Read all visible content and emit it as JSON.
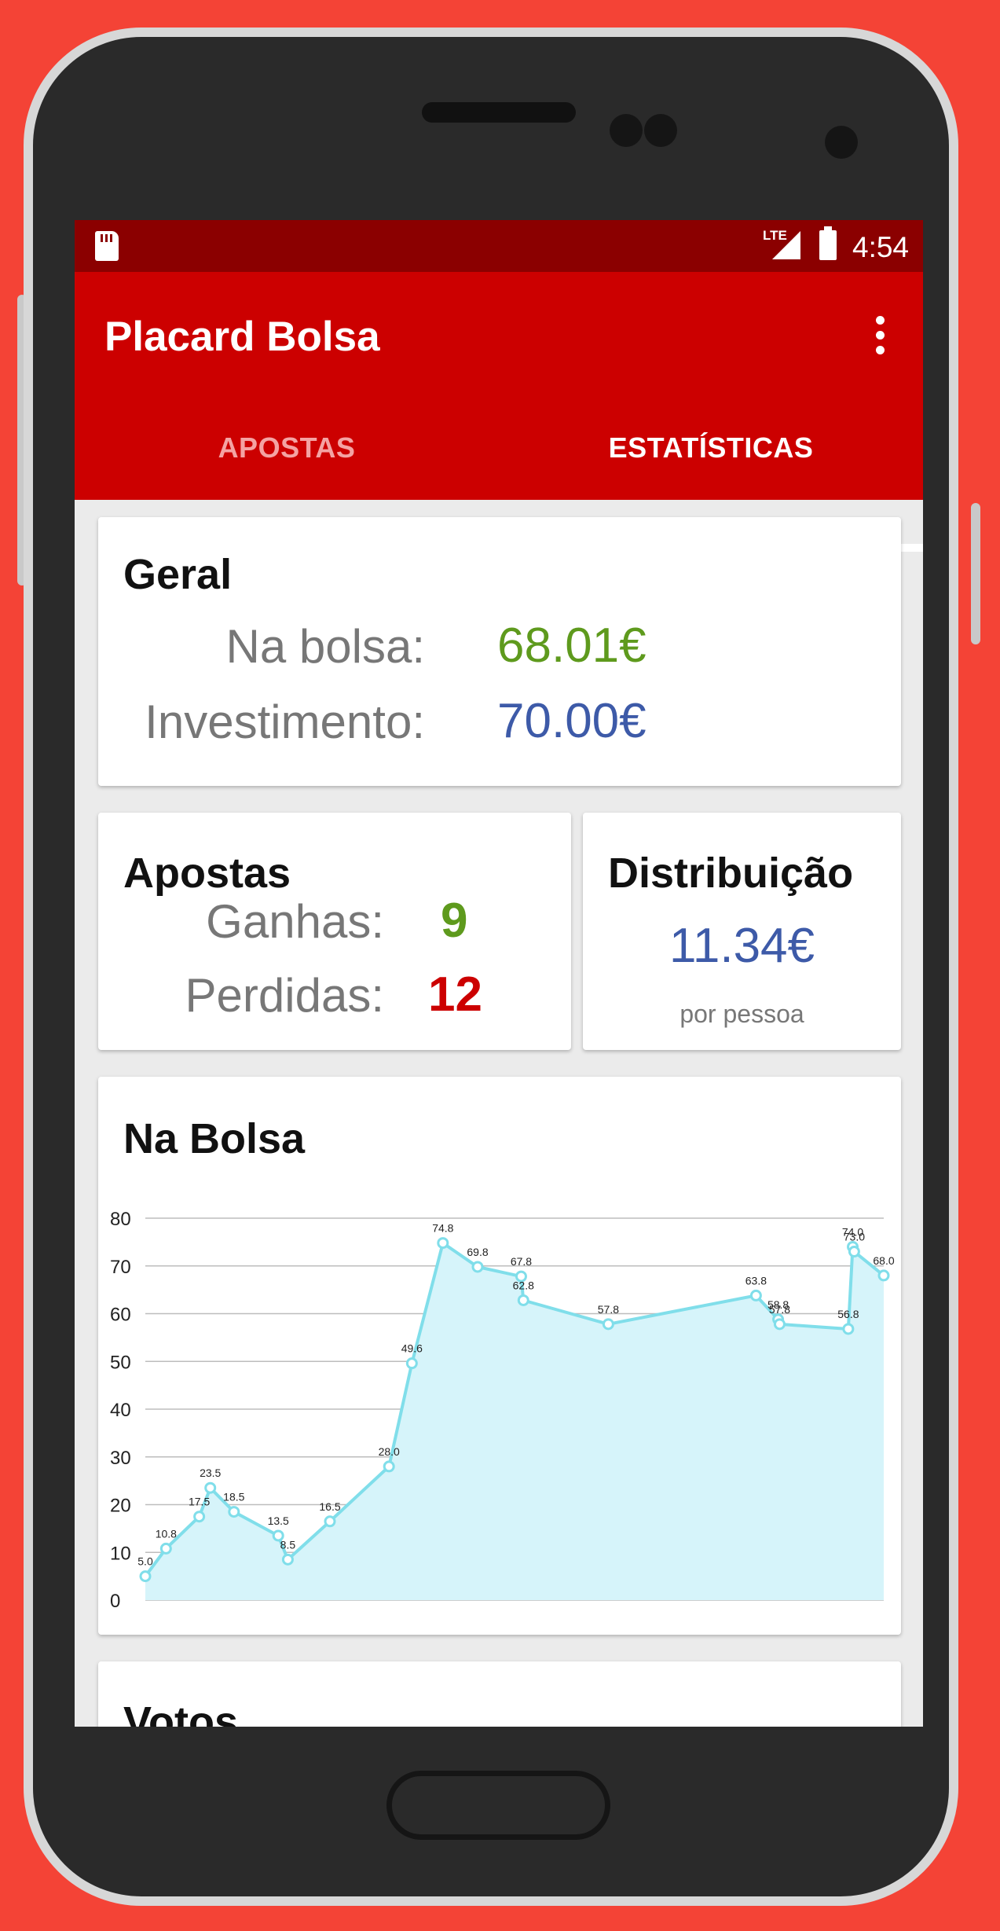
{
  "status_bar": {
    "network": "LTE",
    "time": "4:54"
  },
  "app": {
    "title": "Placard Bolsa"
  },
  "tabs": [
    {
      "label": "APOSTAS",
      "selected": false
    },
    {
      "label": "ESTATÍSTICAS",
      "selected": true
    }
  ],
  "geral": {
    "title": "Geral",
    "na_bolsa_label": "Na bolsa:",
    "na_bolsa_value": "68.01€",
    "investimento_label": "Investimento:",
    "investimento_value": "70.00€"
  },
  "apostas": {
    "title": "Apostas",
    "ganhas_label": "Ganhas:",
    "ganhas_value": "9",
    "perdidas_label": "Perdidas:",
    "perdidas_value": "12"
  },
  "distribuicao": {
    "title": "Distribuição",
    "value": "11.34€",
    "caption": "por pessoa"
  },
  "na_bolsa_chart_title": "Na Bolsa",
  "votos_title": "Votos",
  "colors": {
    "appbar": "#cc0000",
    "statusbar": "#8b0000",
    "positive": "#5e9a1d",
    "neutral": "#3d5aa8",
    "negative": "#cc0000",
    "line": "#80deea",
    "area": "#d6f4fa"
  },
  "chart_data": {
    "type": "area",
    "title": "",
    "xlabel": "",
    "ylabel": "",
    "ylim": [
      0,
      80
    ],
    "yticks": [
      "0",
      "10",
      "20",
      "30",
      "40",
      "50",
      "60",
      "70",
      "80"
    ],
    "grid": true,
    "series": [
      {
        "values": [
          5.0,
          10.8,
          17.5,
          23.5,
          18.5,
          13.5,
          8.5,
          16.5,
          28.0,
          49.6,
          74.8,
          69.8,
          67.8,
          62.8,
          57.8,
          63.8,
          58.8,
          57.8,
          56.8,
          74.0,
          73.0,
          68.0
        ],
        "labels": [
          "5.0",
          "10.8",
          "17.5",
          "23.5",
          "18.5",
          "13.5",
          "8.5",
          "16.5",
          "28.0",
          "49.6",
          "74.8",
          "69.8",
          "67.8",
          "62.8",
          "57.8",
          "63.8",
          "58.8",
          "57.8",
          "56.8",
          "74.0",
          "73.0",
          "68.0"
        ]
      }
    ]
  }
}
